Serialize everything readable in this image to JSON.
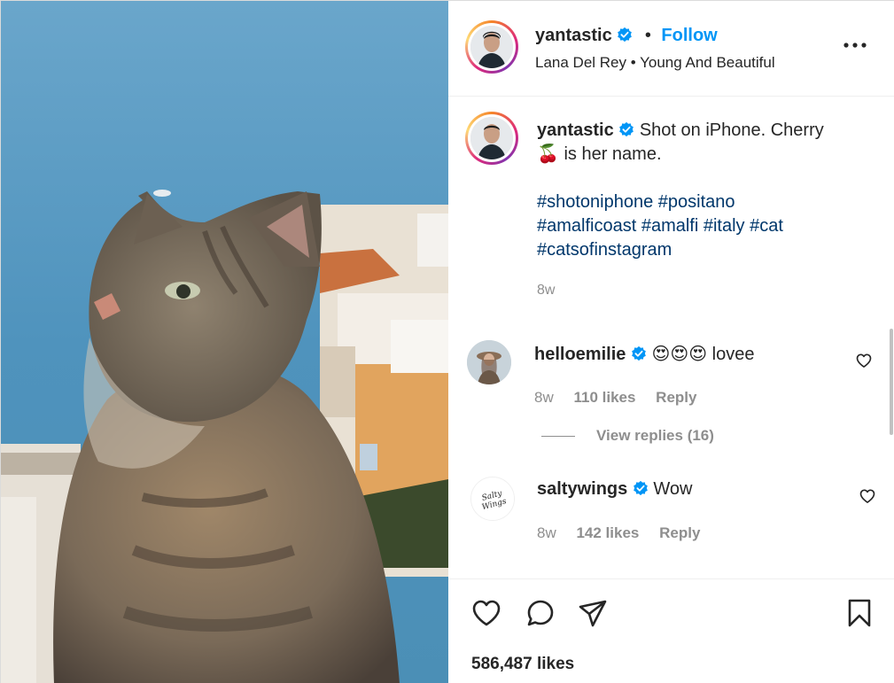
{
  "post": {
    "author": {
      "username": "yantastic",
      "verified": true,
      "follow_label": "Follow",
      "separator": "•",
      "audio": "Lana Del Rey • Young And Beautiful"
    },
    "caption": {
      "username": "yantastic",
      "text_line1": "Shot on iPhone. Cherry",
      "cherry_emoji": "🍒",
      "text_line2": "is her name.",
      "hashtags_line1": "#shotoniphone #positano",
      "hashtags_line2": "#amalficoast #amalfi #italy #cat",
      "hashtags_line3": "#catsofinstagram",
      "time": "8w"
    },
    "comments": [
      {
        "username": "helloemilie",
        "verified": true,
        "emojis": "😍😍😍",
        "text": "lovee",
        "time": "8w",
        "likes": "110 likes",
        "reply_label": "Reply",
        "view_replies": "View replies (16)"
      },
      {
        "username": "saltywings",
        "verified": true,
        "text": "Wow",
        "time": "8w",
        "likes": "142 likes",
        "reply_label": "Reply",
        "avatar_text": "Salty Wings"
      }
    ],
    "like_count": "586,487 likes"
  },
  "icons": {
    "verified": "verified-badge-icon",
    "more": "more-options-icon",
    "like": "heart-icon",
    "comment": "comment-icon",
    "share": "paper-plane-icon",
    "save": "bookmark-icon"
  },
  "colors": {
    "link_blue": "#0095f6",
    "hashtag_blue": "#00376b",
    "muted_gray": "#8e8e8e",
    "text": "#262626"
  }
}
